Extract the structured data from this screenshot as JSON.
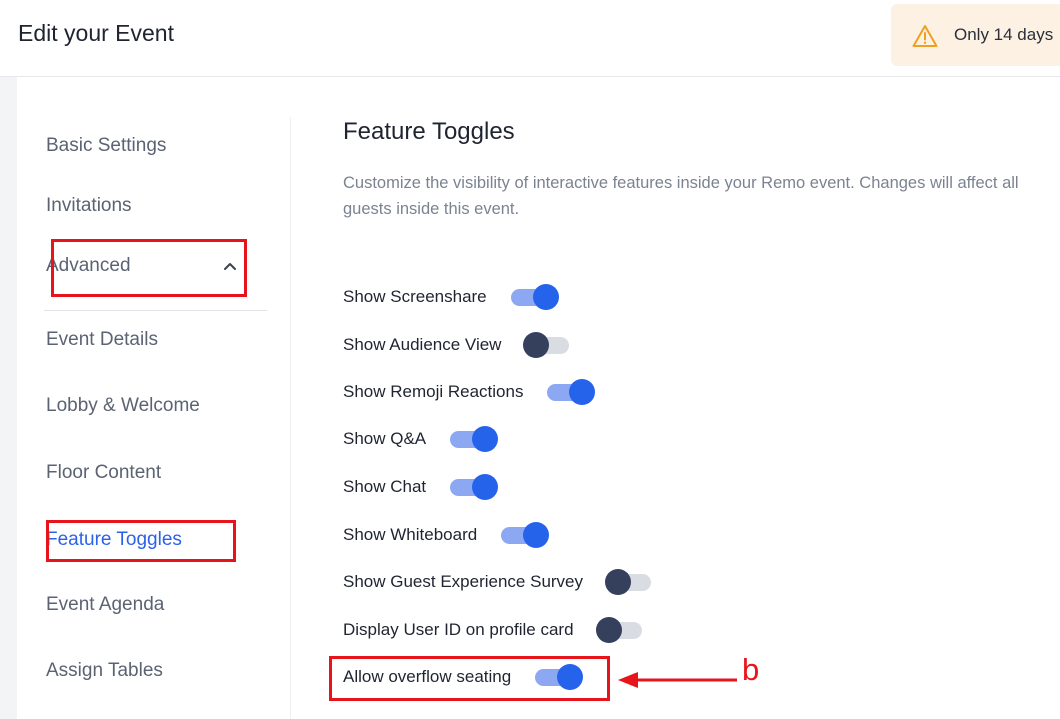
{
  "header": {
    "title": "Edit your Event",
    "trial_text": "Only 14 days"
  },
  "sidebar": {
    "items": [
      {
        "label": "Basic Settings"
      },
      {
        "label": "Invitations"
      },
      {
        "label": "Advanced"
      },
      {
        "label": "Event Details"
      },
      {
        "label": "Lobby & Welcome"
      },
      {
        "label": "Floor Content"
      },
      {
        "label": "Feature Toggles",
        "active": true
      },
      {
        "label": "Event Agenda"
      },
      {
        "label": "Assign Tables"
      }
    ]
  },
  "main": {
    "title": "Feature Toggles",
    "description": "Customize the visibility of interactive features inside your Remo event. Changes will affect all guests inside this event.",
    "toggles": [
      {
        "label": "Show Screenshare",
        "on": true
      },
      {
        "label": "Show Audience View",
        "on": false
      },
      {
        "label": "Show Remoji Reactions",
        "on": true
      },
      {
        "label": "Show Q&A",
        "on": true
      },
      {
        "label": "Show Chat",
        "on": true
      },
      {
        "label": "Show Whiteboard",
        "on": true
      },
      {
        "label": "Show Guest Experience Survey",
        "on": false
      },
      {
        "label": "Display User ID on profile card",
        "on": false
      },
      {
        "label": "Allow overflow seating",
        "on": true
      }
    ]
  },
  "annotation": {
    "label": "b"
  },
  "colors": {
    "accent": "#2563eb",
    "highlight": "#e8141b",
    "banner_bg": "#fdf1e3"
  }
}
